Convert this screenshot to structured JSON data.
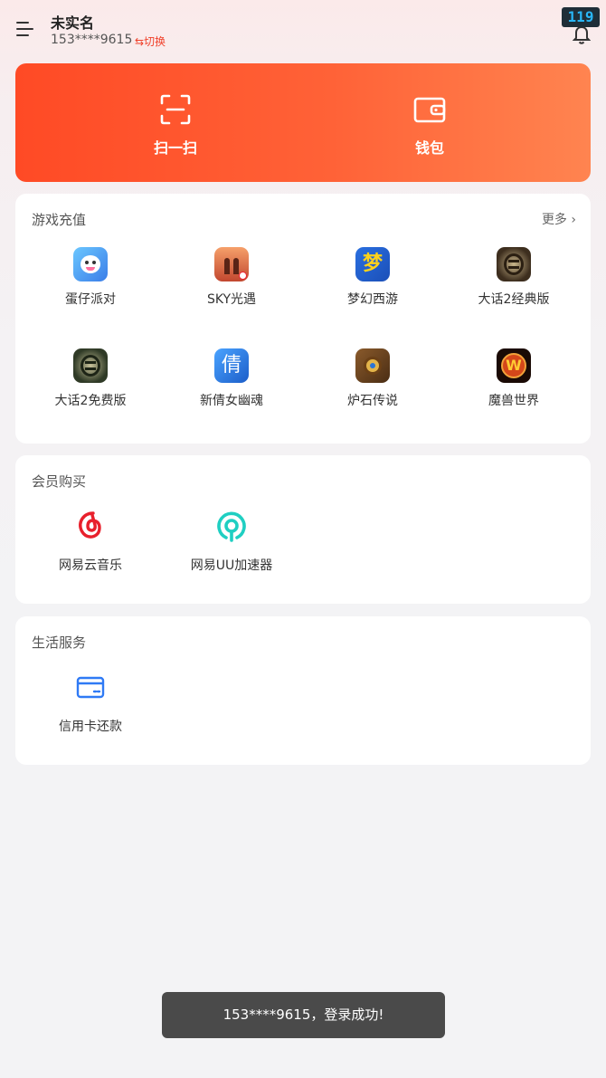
{
  "header": {
    "user_name": "未实名",
    "phone": "153****9615",
    "switch_label": "⇆切换",
    "notification_badge": "119"
  },
  "hero": {
    "scan_label": "扫一扫",
    "wallet_label": "钱包"
  },
  "game_recharge": {
    "title": "游戏充值",
    "more_label": "更多",
    "games": [
      {
        "label": "蛋仔派对",
        "icon": "eggy-party-icon"
      },
      {
        "label": "SKY光遇",
        "icon": "sky-icon"
      },
      {
        "label": "梦幻西游",
        "icon": "menghuan-xiyou-icon"
      },
      {
        "label": "大话2经典版",
        "icon": "dahua2-classic-icon"
      },
      {
        "label": "大话2免费版",
        "icon": "dahua2-free-icon"
      },
      {
        "label": "新倩女幽魂",
        "icon": "qiannv-youhun-icon"
      },
      {
        "label": "炉石传说",
        "icon": "hearthstone-icon"
      },
      {
        "label": "魔兽世界",
        "icon": "world-of-warcraft-icon"
      }
    ]
  },
  "membership": {
    "title": "会员购买",
    "items": [
      {
        "label": "网易云音乐",
        "icon": "netease-music-icon"
      },
      {
        "label": "网易UU加速器",
        "icon": "uu-accelerator-icon"
      }
    ]
  },
  "life_services": {
    "title": "生活服务",
    "items": [
      {
        "label": "信用卡还款",
        "icon": "credit-card-icon"
      }
    ]
  },
  "toast": {
    "message": "153****9615，登录成功!"
  },
  "colors": {
    "accent": "#ff5a30",
    "switch": "#f0402a",
    "toast_bg": "#4a4a4a"
  }
}
